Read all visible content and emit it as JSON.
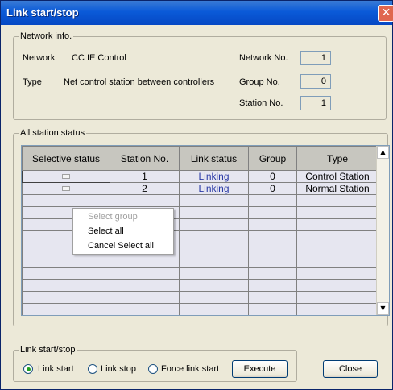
{
  "window": {
    "title": "Link start/stop",
    "close_glyph": "✕"
  },
  "network_info": {
    "legend": "Network info.",
    "network_label": "Network",
    "network_value": "CC IE Control",
    "type_label": "Type",
    "type_value": "Net control station between controllers",
    "network_no_label": "Network No.",
    "network_no_value": "1",
    "group_no_label": "Group No.",
    "group_no_value": "0",
    "station_no_label": "Station No.",
    "station_no_value": "1"
  },
  "station_status": {
    "legend": "All station status",
    "columns": [
      "Selective status",
      "Station No.",
      "Link status",
      "Group",
      "Type"
    ],
    "rows": [
      {
        "station_no": "1",
        "link_status": "Linking",
        "group": "0",
        "type": "Control Station"
      },
      {
        "station_no": "2",
        "link_status": "Linking",
        "group": "0",
        "type": "Normal Station"
      }
    ],
    "scroll_up_glyph": "▲",
    "scroll_down_glyph": "▼"
  },
  "context_menu": {
    "items": [
      {
        "label": "Select group",
        "enabled": false
      },
      {
        "label": "Select all",
        "enabled": true
      },
      {
        "label": "Cancel Select all",
        "enabled": true
      }
    ]
  },
  "link_control": {
    "legend": "Link start/stop",
    "options": [
      "Link start",
      "Link stop",
      "Force link start"
    ],
    "selected": "Link start",
    "execute_label": "Execute"
  },
  "close_label": "Close",
  "colors": {
    "title_bar": "#0a5ad8",
    "link_text": "#2a3aa6",
    "dialog_bg": "#ece9d8",
    "radio_selected": "#21a121"
  }
}
